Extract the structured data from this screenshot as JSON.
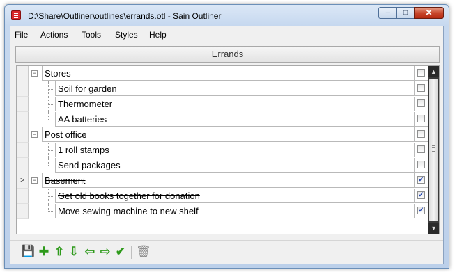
{
  "window": {
    "title": "D:\\Share\\Outliner\\outlines\\errands.otl - Sain Outliner"
  },
  "controls": {
    "minimize": "–",
    "maximize": "□",
    "close": "✕"
  },
  "menu": [
    "File",
    "Actions",
    "Tools",
    "Styles",
    "Help"
  ],
  "outline": {
    "header": "Errands",
    "rows": [
      {
        "label": "Stores",
        "level": 0,
        "expander": "−",
        "checked": false,
        "done": false
      },
      {
        "label": "Soil for garden",
        "level": 1,
        "checked": false,
        "done": false
      },
      {
        "label": "Thermometer",
        "level": 1,
        "checked": false,
        "done": false
      },
      {
        "label": "AA batteries",
        "level": 1,
        "checked": false,
        "done": false
      },
      {
        "label": "Post office",
        "level": 0,
        "expander": "−",
        "checked": false,
        "done": false
      },
      {
        "label": "1 roll stamps",
        "level": 1,
        "checked": false,
        "done": false
      },
      {
        "label": "Send packages",
        "level": 1,
        "checked": false,
        "done": false
      },
      {
        "label": "Basement",
        "level": 0,
        "expander": "−",
        "checked": true,
        "done": true,
        "current": true
      },
      {
        "label": "Get old books together for donation",
        "level": 1,
        "checked": true,
        "done": true
      },
      {
        "label": "Move sewing machine to new shelf",
        "level": 1,
        "checked": true,
        "done": true
      }
    ],
    "current_row_marker": ">"
  },
  "toolbar": [
    {
      "name": "save-icon",
      "glyph": "💾"
    },
    {
      "name": "add-icon",
      "glyph": "✚"
    },
    {
      "name": "move-up-icon",
      "glyph": "⇧"
    },
    {
      "name": "move-down-icon",
      "glyph": "⇩"
    },
    {
      "name": "outdent-icon",
      "glyph": "⇦"
    },
    {
      "name": "indent-icon",
      "glyph": "⇨"
    },
    {
      "name": "check-icon",
      "glyph": "✔"
    },
    {
      "name": "trash-icon",
      "glyph": "🗑"
    }
  ]
}
